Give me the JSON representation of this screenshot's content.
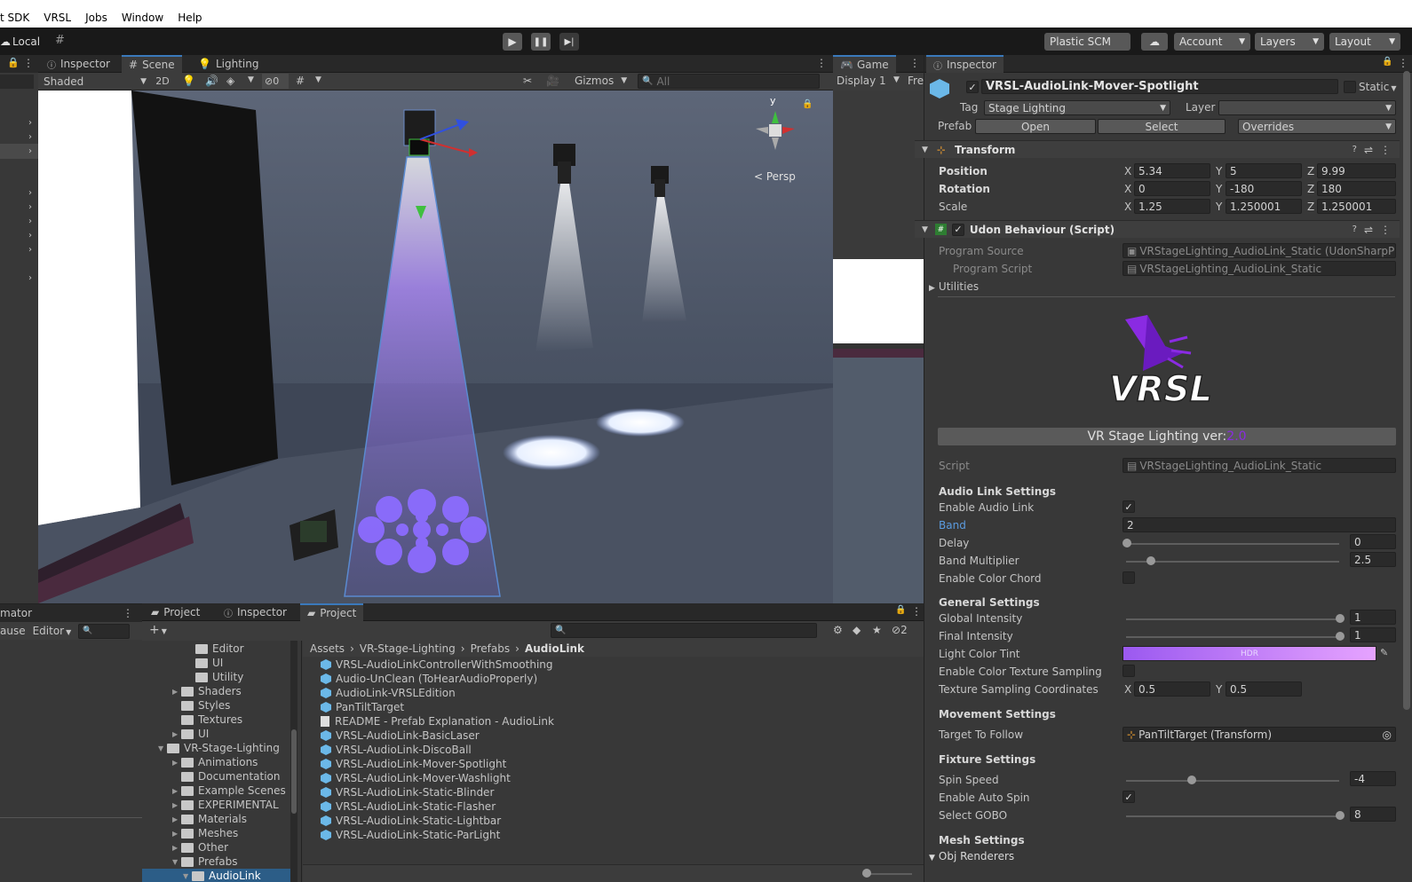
{
  "menu": [
    "t SDK",
    "VRSL",
    "Jobs",
    "Window",
    "Help"
  ],
  "toolbar": {
    "local": "Local",
    "plastic": "Plastic SCM",
    "account": "Account",
    "layers": "Layers",
    "layout": "Layout"
  },
  "left_tabs": {
    "inspector": "Inspector",
    "scene": "Scene",
    "lighting": "Lighting"
  },
  "scene_toolbar": {
    "shading": "Shaded",
    "mode2d": "2D",
    "hidden_count": "0",
    "gizmos": "Gizmos",
    "search_placeholder": "All"
  },
  "scene_view": {
    "persp": "< Persp",
    "axis_y": "y"
  },
  "game": {
    "tab": "Game",
    "display": "Display 1",
    "free": "Fre"
  },
  "inspector": {
    "tab": "Inspector",
    "object_name": "VRSL-AudioLink-Mover-Spotlight",
    "static_label": "Static",
    "tag_label": "Tag",
    "tag_value": "Stage Lighting",
    "layer_label": "Layer",
    "prefab_label": "Prefab",
    "open": "Open",
    "select": "Select",
    "overrides": "Overrides",
    "transform": {
      "title": "Transform",
      "position": {
        "label": "Position",
        "x": "5.34",
        "y": "5",
        "z": "9.99"
      },
      "rotation": {
        "label": "Rotation",
        "x": "0",
        "y": "-180",
        "z": "180"
      },
      "scale": {
        "label": "Scale",
        "x": "1.25",
        "y": "1.250001",
        "z": "1.250001"
      }
    },
    "axis": {
      "x": "X",
      "y": "Y",
      "z": "Z"
    },
    "udon": {
      "title": "Udon Behaviour (Script)",
      "program_source_label": "Program Source",
      "program_source": "VRStageLighting_AudioLink_Static (UdonSharpP",
      "program_script_label": "Program Script",
      "program_script": "VRStageLighting_AudioLink_Static",
      "utilities": "Utilities"
    },
    "logo_text": "VRSL",
    "version_label": "VR Stage Lighting ver: ",
    "version": "2.0",
    "script_label": "Script",
    "script_value": "VRStageLighting_AudioLink_Static",
    "audio_link": {
      "title": "Audio Link Settings",
      "enable": "Enable Audio Link",
      "band": "Band",
      "band_value": "2",
      "delay": "Delay",
      "delay_value": "0",
      "band_mult": "Band Multiplier",
      "band_mult_value": "2.5",
      "color_chord": "Enable Color Chord"
    },
    "general": {
      "title": "General Settings",
      "global": "Global Intensity",
      "global_value": "1",
      "final": "Final Intensity",
      "final_value": "1",
      "tint": "Light Color Tint",
      "hdr": "HDR",
      "tex_sampling": "Enable Color Texture Sampling",
      "tex_coords": "Texture Sampling Coordinates",
      "tex_x": "0.5",
      "tex_y": "0.5"
    },
    "movement": {
      "title": "Movement Settings",
      "target": "Target To Follow",
      "target_value": "PanTiltTarget (Transform)"
    },
    "fixture": {
      "title": "Fixture Settings",
      "spin": "Spin Speed",
      "spin_value": "-4",
      "auto_spin": "Enable Auto Spin",
      "gobo": "Select GOBO",
      "gobo_value": "8"
    },
    "mesh": {
      "title": "Mesh Settings",
      "renderers": "Obj Renderers"
    }
  },
  "bottom": {
    "animator_tab": "mator",
    "pause": "ause",
    "editor": "Editor",
    "tabs": [
      "Project",
      "Inspector",
      "Project"
    ],
    "hidden_count": "2",
    "breadcrumb": [
      "Assets",
      "VR-Stage-Lighting",
      "Prefabs",
      "AudioLink"
    ],
    "tree": [
      "Editor",
      "UI",
      "Utility",
      "Shaders",
      "Styles",
      "Textures",
      "UI",
      "VR-Stage-Lighting",
      "Animations",
      "Documentation",
      "Example Scenes",
      "EXPERIMENTAL",
      "Materials",
      "Meshes",
      "Other",
      "Prefabs",
      "AudioLink"
    ],
    "files": [
      "VRSL-AudioLinkControllerWithSmoothing",
      "Audio-UnClean (ToHearAudioProperly)",
      "AudioLink-VRSLEdition",
      "PanTiltTarget",
      "README - Prefab Explanation - AudioLink",
      "VRSL-AudioLink-BasicLaser",
      "VRSL-AudioLink-DiscoBall",
      "VRSL-AudioLink-Mover-Spotlight",
      "VRSL-AudioLink-Mover-Washlight",
      "VRSL-AudioLink-Static-Blinder",
      "VRSL-AudioLink-Static-Flasher",
      "VRSL-AudioLink-Static-Lightbar",
      "VRSL-AudioLink-Static-ParLight"
    ]
  },
  "colors": {
    "accent": "#3a79bb",
    "vrsl_purple": "#8a2be2",
    "tint_start": "#9b59f0",
    "tint_end": "#e6a3ff"
  }
}
